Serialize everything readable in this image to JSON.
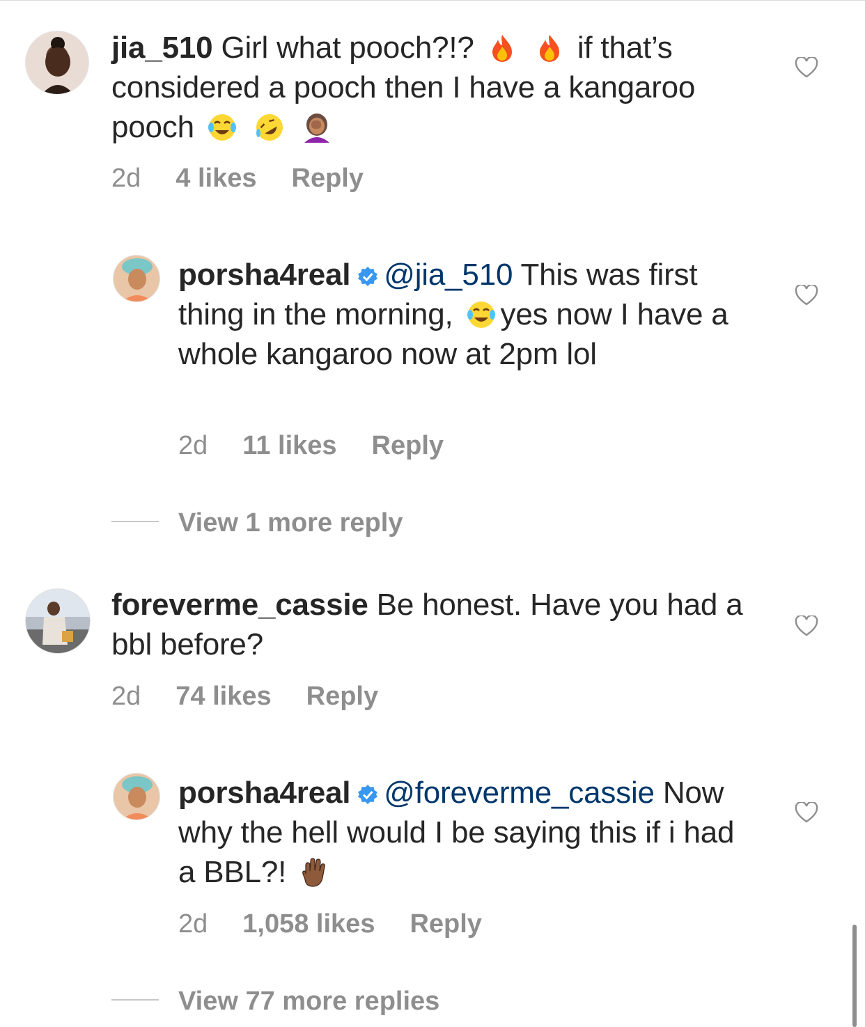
{
  "comments": [
    {
      "username": "jia_510",
      "text_1": "Girl what pooch?!?",
      "text_2": "if that’s considered a pooch then I have a kangaroo pooch",
      "time": "2d",
      "likes": "4 likes",
      "reply_label": "Reply",
      "emoji_1": "fire-emoji",
      "emoji_2": "fire-emoji",
      "emoji_3": "tears-of-joy-emoji",
      "emoji_4": "rolling-laughing-emoji",
      "emoji_5": "facepalm-emoji"
    },
    {
      "username": "porsha4real",
      "mention": "@jia_510",
      "text_1": "This was first thing in the morning,",
      "text_2": "yes now I have a whole kangaroo now at 2pm lol",
      "time": "2d",
      "likes": "11 likes",
      "reply_label": "Reply",
      "emoji_1": "tears-of-joy-emoji"
    },
    {
      "username": "foreverme_cassie",
      "text_1": "Be honest. Have you had a bbl before?",
      "time": "2d",
      "likes": "74 likes",
      "reply_label": "Reply"
    },
    {
      "username": "porsha4real",
      "mention": "@foreverme_cassie",
      "text_1": "Now why the hell would I be saying this if i had a BBL?!",
      "time": "2d",
      "likes": "1,058 likes",
      "reply_label": "Reply",
      "emoji_1": "raised-hand-emoji"
    }
  ],
  "view_more_1": "View 1 more reply",
  "view_more_2": "View 77 more replies",
  "colors": {
    "text": "#262626",
    "meta": "#8e8e8e",
    "mention": "#00376b",
    "verified": "#3897f0"
  }
}
